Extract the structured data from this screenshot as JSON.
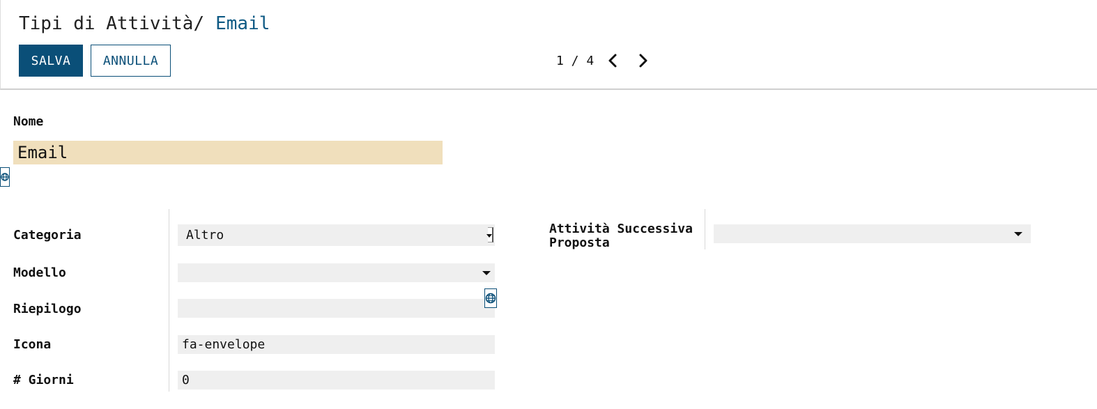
{
  "breadcrumb": {
    "parent": "Tipi di Attività",
    "separator": "/",
    "current": "Email"
  },
  "buttons": {
    "save_label": "SALVA",
    "cancel_label": "ANNULLA"
  },
  "pager": {
    "value": "1 / 4"
  },
  "form": {
    "name_label": "Nome",
    "name_value": "Email",
    "category_label": "Categoria",
    "category_value": "Altro",
    "model_label": "Modello",
    "model_value": "",
    "summary_label": "Riepilogo",
    "summary_value": "",
    "icon_label": "Icona",
    "icon_value": "fa-envelope",
    "days_label": "# Giorni",
    "days_value": "0",
    "next_activity_label_line1": "Attività Successiva",
    "next_activity_label_line2": "Proposta",
    "next_activity_value": ""
  },
  "colors": {
    "primary": "#0a4f78",
    "required_field_bg": "#f0dfbc",
    "field_bg": "#efefef"
  },
  "icons": {
    "prev": "chevron-left-icon",
    "next": "chevron-right-icon",
    "translate": "globe-icon",
    "dropdown": "caret-down-icon"
  }
}
